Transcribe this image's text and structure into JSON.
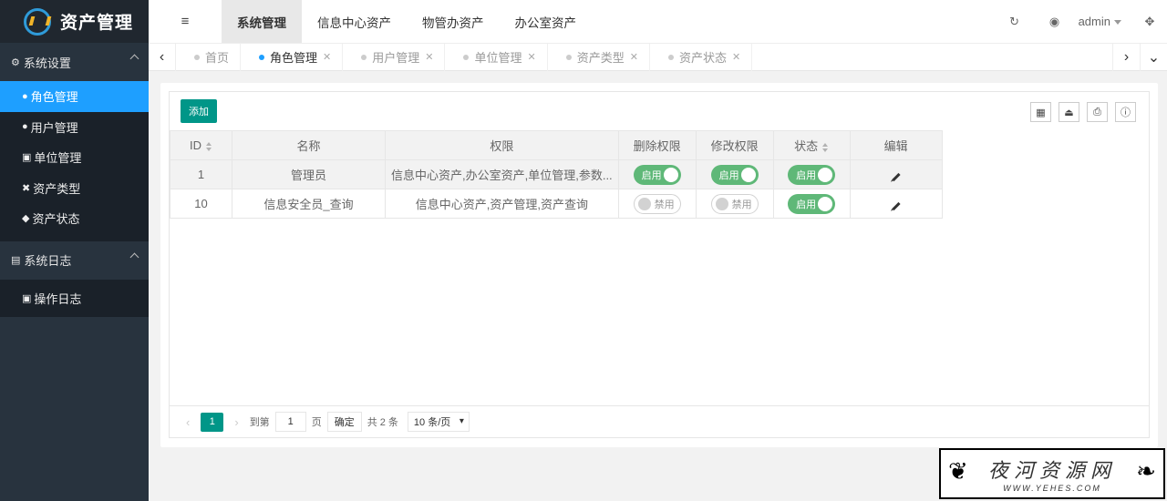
{
  "app": {
    "title": "资产管理"
  },
  "sidebar": {
    "groups": [
      {
        "label": "系统设置",
        "icon": "cogs-icon",
        "items": [
          {
            "label": "角色管理",
            "icon": "user-icon",
            "active": true
          },
          {
            "label": "用户管理",
            "icon": "user-icon"
          },
          {
            "label": "单位管理",
            "icon": "bank-icon"
          },
          {
            "label": "资产类型",
            "icon": "cross-icon"
          },
          {
            "label": "资产状态",
            "icon": "cube-icon"
          }
        ]
      },
      {
        "label": "系统日志",
        "icon": "file-icon",
        "items": [
          {
            "label": "操作日志",
            "icon": "doc-icon"
          }
        ]
      }
    ]
  },
  "header": {
    "menu_icon": "≡",
    "tabs": [
      "系统管理",
      "信息中心资产",
      "物管办资产",
      "办公室资产"
    ],
    "user": "admin"
  },
  "tabstrip": {
    "tabs": [
      "首页",
      "角色管理",
      "用户管理",
      "单位管理",
      "资产类型",
      "资产状态"
    ]
  },
  "toolbar": {
    "add_label": "添加"
  },
  "table": {
    "columns": [
      "ID",
      "名称",
      "权限",
      "删除权限",
      "修改权限",
      "状态",
      "编辑"
    ],
    "rows": [
      {
        "id": "1",
        "name": "管理员",
        "perm": "信息中心资产,办公室资产,单位管理,参数...",
        "del": "启用",
        "mod": "启用",
        "status": "启用"
      },
      {
        "id": "10",
        "name": "信息安全员_查询",
        "perm": "信息中心资产,资产管理,资产查询",
        "del": "禁用",
        "mod": "禁用",
        "status": "启用"
      }
    ]
  },
  "pager": {
    "current": "1",
    "goto_label": "到第",
    "goto_value": "1",
    "page_label": "页",
    "confirm": "确定",
    "total": "共 2 条",
    "size": "10 条/页"
  },
  "watermark": {
    "main": "夜河资源网",
    "sub": "WWW.YEHES.COM"
  }
}
